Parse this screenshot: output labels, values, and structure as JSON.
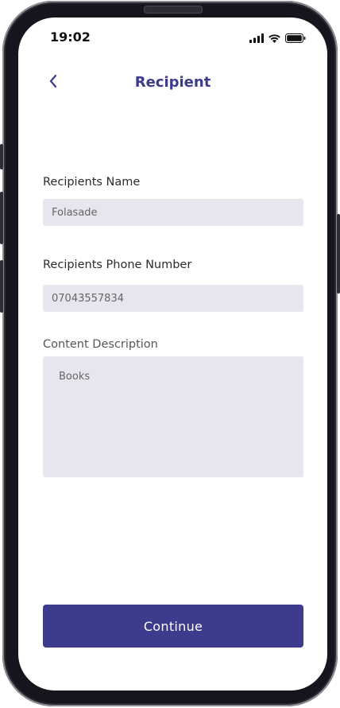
{
  "status_bar": {
    "time": "19:02",
    "icons": [
      "signal-icon",
      "wifi-icon",
      "battery-icon"
    ]
  },
  "header": {
    "back_icon": "chevron-left-icon",
    "title": "Recipient"
  },
  "form": {
    "name": {
      "label": "Recipients Name",
      "value": "Folasade"
    },
    "phone": {
      "label": "Recipients Phone Number",
      "value": "07043557834"
    },
    "description": {
      "label": "Content Description",
      "value": "Books"
    }
  },
  "actions": {
    "continue_label": "Continue"
  },
  "colors": {
    "primary": "#3d3b8e",
    "input_background": "#e6e6ef",
    "device_frame": "#16151d"
  }
}
